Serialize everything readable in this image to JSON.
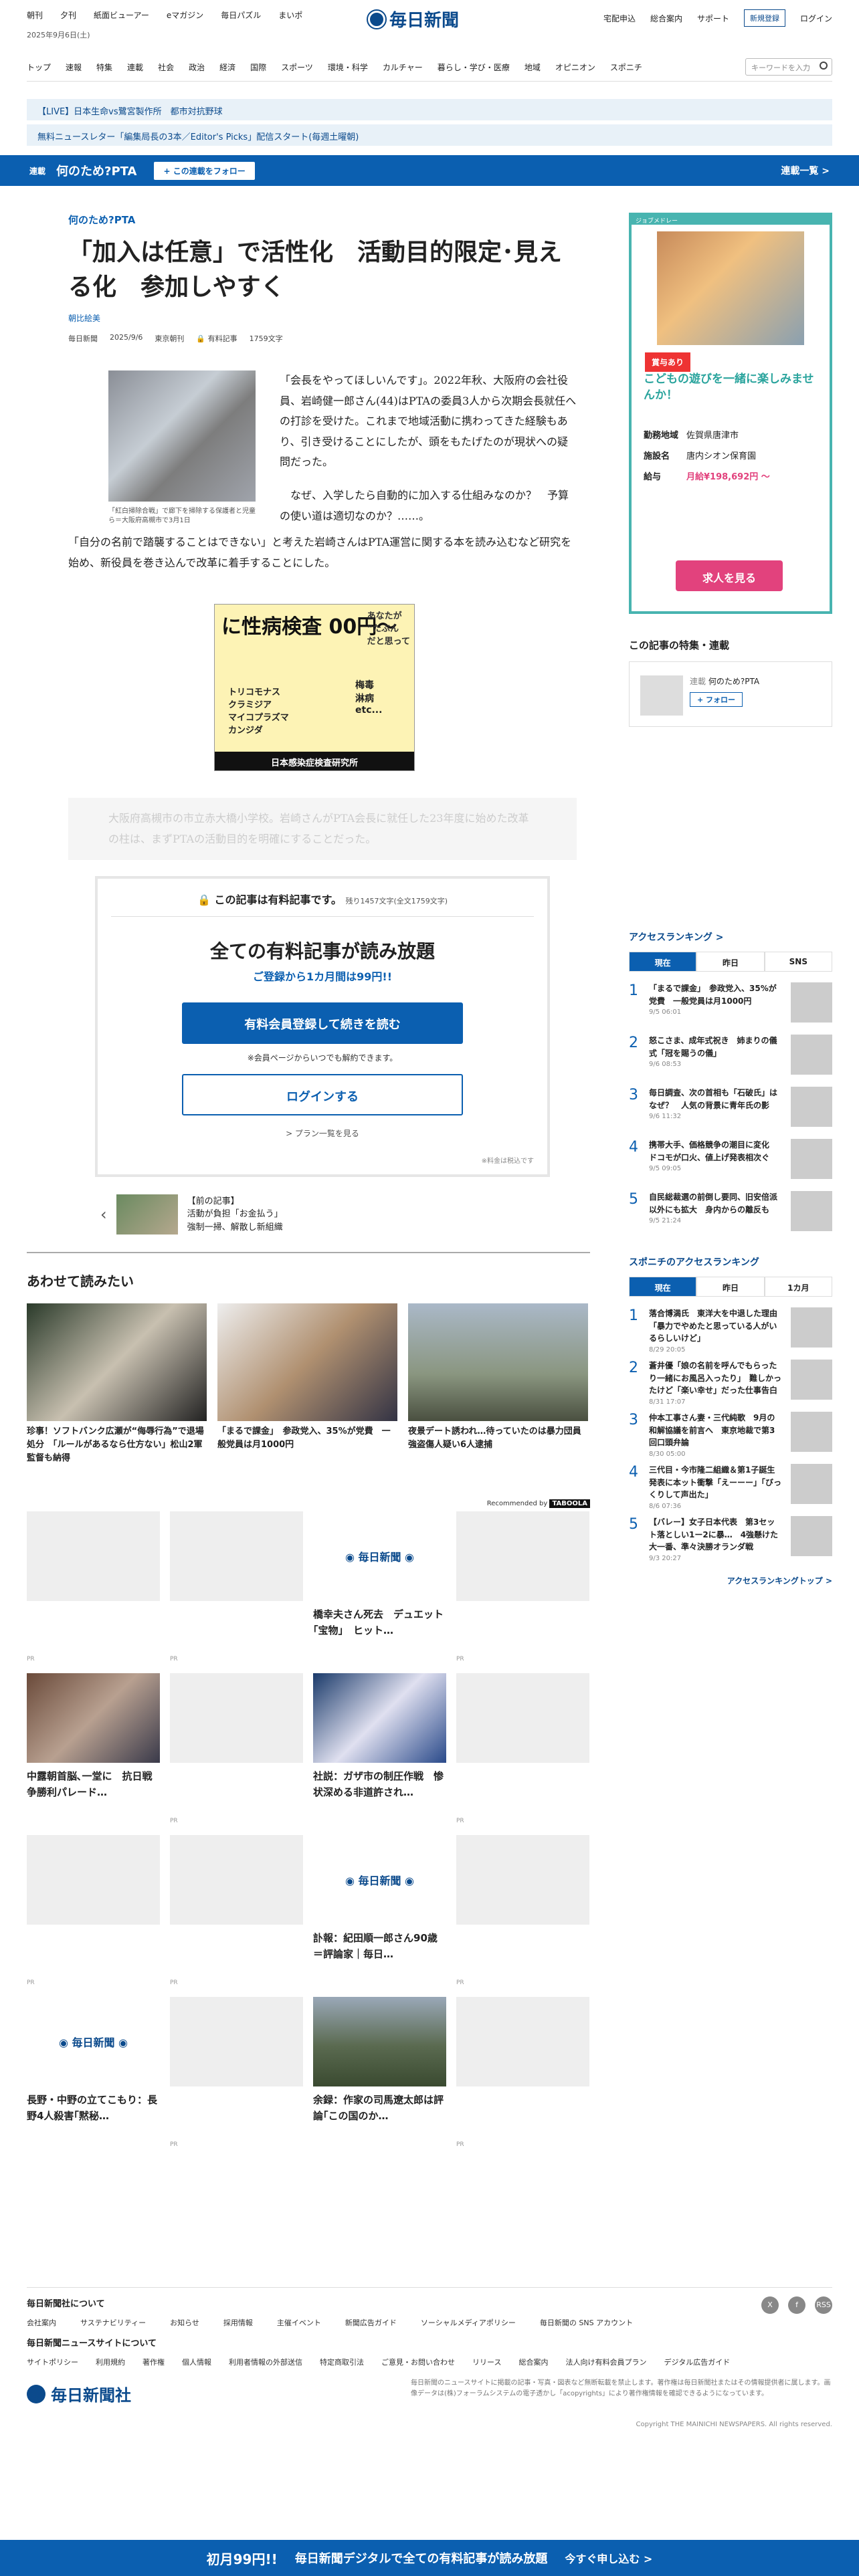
{
  "header": {
    "topnav": [
      "朝刊",
      "夕刊",
      "紙面ビューアー",
      "eマガジン",
      "毎日パズル",
      "まいポ"
    ],
    "date": "2025年9月6日(土)",
    "logo": "毎日新聞",
    "right": [
      "宅配申込",
      "総合案内",
      "サポート"
    ],
    "subscribe": "新規登録",
    "login": "ログイン"
  },
  "mainnav": {
    "items": [
      "トップ",
      "速報",
      "特集",
      "連載",
      "社会",
      "政治",
      "経済",
      "国際",
      "スポーツ",
      "環境・科学",
      "カルチャー",
      "暮らし・学び・医療",
      "地域",
      "オピニオン",
      "スポニチ"
    ],
    "search_placeholder": "キーワードを入力"
  },
  "alerts": {
    "a1": "【LIVE】日本生命vs鷺宮製作所　都市対抗野球",
    "a2": "無料ニュースレター「編集局長の3本／Editor's Picks」配信スタート(毎週土曜朝)"
  },
  "rensai": {
    "tag": "連載",
    "name": "何のため?PTA",
    "follow": "+ この連載をフォロー",
    "list": "連載一覧 >"
  },
  "article": {
    "kicker": "何のため?PTA",
    "title": "「加入は任意」で活性化　活動目的限定･見える化　参加しやすく",
    "author": "朝比絵美",
    "meta": [
      "毎日新聞",
      "2025/9/6",
      "東京朝刊",
      "有料記事",
      "1759文字"
    ],
    "photo_caption": "「紅白掃除合戦」で廊下を掃除する保護者と児童ら＝大阪府高槻市で3月1日",
    "p1": "「会長をやってほしいんです」。2022年秋、大阪府の会社役員、岩崎健一郎さん(44)はPTAの委員3人から次期会長就任への打診を受けた。これまで地域活動に携わってきた経験もあり、引き受けることにしたが、頭をもたげたのが現状への疑問だった。",
    "p2": "なぜ、入学したら自動的に加入する仕組みなのか？　予算の使い道は適切なのか？……。",
    "p3": "「自分の名前で踏襲することはできない」と考えた岩崎さんはPTA運営に関する本を読み込むなど研究を始め、新役員を巻き込んで改革に着手することにした。",
    "fade": "大阪府高槻市の市立赤大橋小学校。岩崎さんがPTA会長に就任した23年度に始めた改革の柱は、まずPTAの活動目的を明確にすることだった。"
  },
  "ad1": {
    "headline": "に性病検査 00円〜",
    "bubble1": "あなたが\n“たぶん\nだと思って",
    "bubble2": "トリコモナス\nクラミジア\nマイコプラズマ\nカンジダ",
    "bubble3": "梅毒\n淋病\netc...",
    "footer": "日本感染症検査研究所"
  },
  "paywall": {
    "head": "この記事は有料記事です。",
    "remain": "残り1457文字(全文1759文字)",
    "big": "全ての有料記事が読み放題",
    "sub": "ご登録から1カ月間は99円!!",
    "register": "有料会員登録して続きを読む",
    "note": "※会員ページからいつでも解約できます。",
    "login": "ログインする",
    "plan": "> プラン一覧を見る",
    "fn": "※料金は税込です"
  },
  "prev_article": {
    "label": "【前の記事】",
    "title": "活動が負担「お金払う」\n強制一掃、解散し新組織"
  },
  "related": {
    "heading": "あわせて読みたい",
    "items": [
      {
        "title": "珍事！ソフトバンク広瀬が“侮辱行為”で退場処分　「ルールがあるなら仕方ない」松山2軍監督も納得"
      },
      {
        "title": "「まるで課金」　参政党入、35%が党費　一般党員は月1000円"
      },
      {
        "title": "夜景デート誘われ…待っていたのは暴力団員　強盗傷人疑い6人逮捕"
      }
    ]
  },
  "recommend": {
    "label": "Recommended by",
    "cells": [
      {
        "title": "",
        "pr": "PR"
      },
      {
        "title": "",
        "pr": "PR"
      },
      {
        "title": "橋幸夫さん死去　デュエット｢宝物｣　ヒット…",
        "pr": ""
      },
      {
        "title": "",
        "pr": "PR"
      },
      {
        "title": "中露朝首脳､一堂に　抗日戦争勝利パレード…",
        "pr": ""
      },
      {
        "title": "",
        "pr": "PR"
      },
      {
        "title": "社説：ガザ市の制圧作戦　惨状深める非道許され…",
        "pr": ""
      },
      {
        "title": "",
        "pr": "PR"
      },
      {
        "title": "",
        "pr": "PR"
      },
      {
        "title": "",
        "pr": "PR"
      },
      {
        "title": "訃報：紀田順一郎さん90歳＝評論家｜毎日…",
        "pr": ""
      },
      {
        "title": "",
        "pr": "PR"
      },
      {
        "title": "長野・中野の立てこもり：長野4人殺害｢黙秘…",
        "pr": ""
      },
      {
        "title": "",
        "pr": "PR"
      },
      {
        "title": "余録：作家の司馬遼太郎は評論｢この国のか…",
        "pr": ""
      },
      {
        "title": "",
        "pr": "PR"
      }
    ]
  },
  "side_ad": {
    "brand": "ジョブメドレー",
    "badge": "賞与あり",
    "title": "こどもの遊びを一緒に楽しみませんか！",
    "rows": [
      [
        "勤務地域",
        "佐賀県唐津市"
      ],
      [
        "施設名",
        "唐内シオン保育園"
      ],
      [
        "給与",
        "月給¥198,692円 〜"
      ]
    ],
    "cta": "求人を見る"
  },
  "side": {
    "tokushu": "この記事の特集・連載",
    "tok_tag": "連載",
    "tok_name": "何のため?PTA",
    "tok_follow": "+ フォロー",
    "ranking_head": "アクセスランキング >",
    "tabs": [
      "現在",
      "昨日",
      "SNS"
    ],
    "ranking": [
      {
        "t": "「まるで課金」　参政党入、35%が党費　一般党員は月1000円",
        "d": "9/5 06:01"
      },
      {
        "t": "怒こさま、成年式祝き　姉まりの儀式「冠を賜うの儀」",
        "d": "9/6 08:53"
      },
      {
        "t": "毎日調査、次の首相も「石破氏」はなぜ？　人気の背景に青年氏の影",
        "d": "9/6 11:32"
      },
      {
        "t": "携帯大手、価格競争の潮目に変化　ドコモが口火、値上げ発表相次ぐ",
        "d": "9/5 09:05"
      },
      {
        "t": "自民総裁選の前倒し要同、旧安倍派以外にも拡大　身内からの離反も",
        "d": "9/5 21:24"
      }
    ],
    "sponichi_head": "スポニチのアクセスランキング",
    "sp_tabs": [
      "現在",
      "昨日",
      "1カ月"
    ],
    "sponichi": [
      {
        "t": "落合博満氏　東洋大を中退した理由「暴力でやめたと思っている人がいるらしいけど」",
        "d": "8/29 20:05"
      },
      {
        "t": "蒼井優「娘の名前を呼んでもらったり一緒にお風呂入ったり」　難しかったけど「楽い幸せ」だった仕事告白",
        "d": "8/31 17:07"
      },
      {
        "t": "仲本工事さん妻・三代純歌　9月の和解協議を前言へ　東京地裁で第3回口頭弁論",
        "d": "8/30 05:00"
      },
      {
        "t": "三代目・今市隆二組織＆第1子誕生発表に本ット衝撃「えーーー」「びっくりして声出た」",
        "d": "8/6 07:36"
      },
      {
        "t": "【バレー】女子日本代表　第3セット落としい1ー2に暴…　4強懸けた大一番、準々決勝オランダ戦",
        "d": "9/3 20:27"
      }
    ],
    "ranking_top": "アクセスランキングトップ >"
  },
  "footer": {
    "h1": "毎日新聞社について",
    "links1": [
      "会社案内",
      "サステナビリティー",
      "お知らせ",
      "採用情報",
      "主催イベント",
      "新聞広告ガイド",
      "ソーシャルメディアポリシー",
      "毎日新聞の SNS アカウント"
    ],
    "h2": "毎日新聞ニュースサイトについて",
    "links2": [
      "サイトポリシー",
      "利用規約",
      "著作権",
      "個人情報",
      "利用者情報の外部送信",
      "特定商取引法",
      "ご意見・お問い合わせ",
      "リリース",
      "総合案内",
      "法人向け有料会員プラン",
      "デジタル広告ガイド"
    ],
    "social": [
      "X",
      "f",
      "RSS"
    ],
    "logo": "毎日新聞社",
    "note": "毎日新聞のニュースサイトに掲載の記事・写真・図表など無断転載を禁止します。著作権は毎日新聞社またはその情報提供者に属します。画像データは(株)フォーラムシステムの電子透かし「acopyrights」により著作権情報を確認できるようになっています。",
    "copy": "Copyright THE MAINICHI NEWSPAPERS. All rights reserved."
  },
  "bottom_bar": {
    "price": "初月99円!!",
    "msg": "毎日新聞デジタルで全ての有料記事が読み放題",
    "cta": "今すぐ申し込む >"
  },
  "colors": {
    "brand": "#0b4a8c",
    "accent": "#0b5fb0",
    "ad_teal": "#48b4b0",
    "ad_pink": "#e2427d"
  }
}
